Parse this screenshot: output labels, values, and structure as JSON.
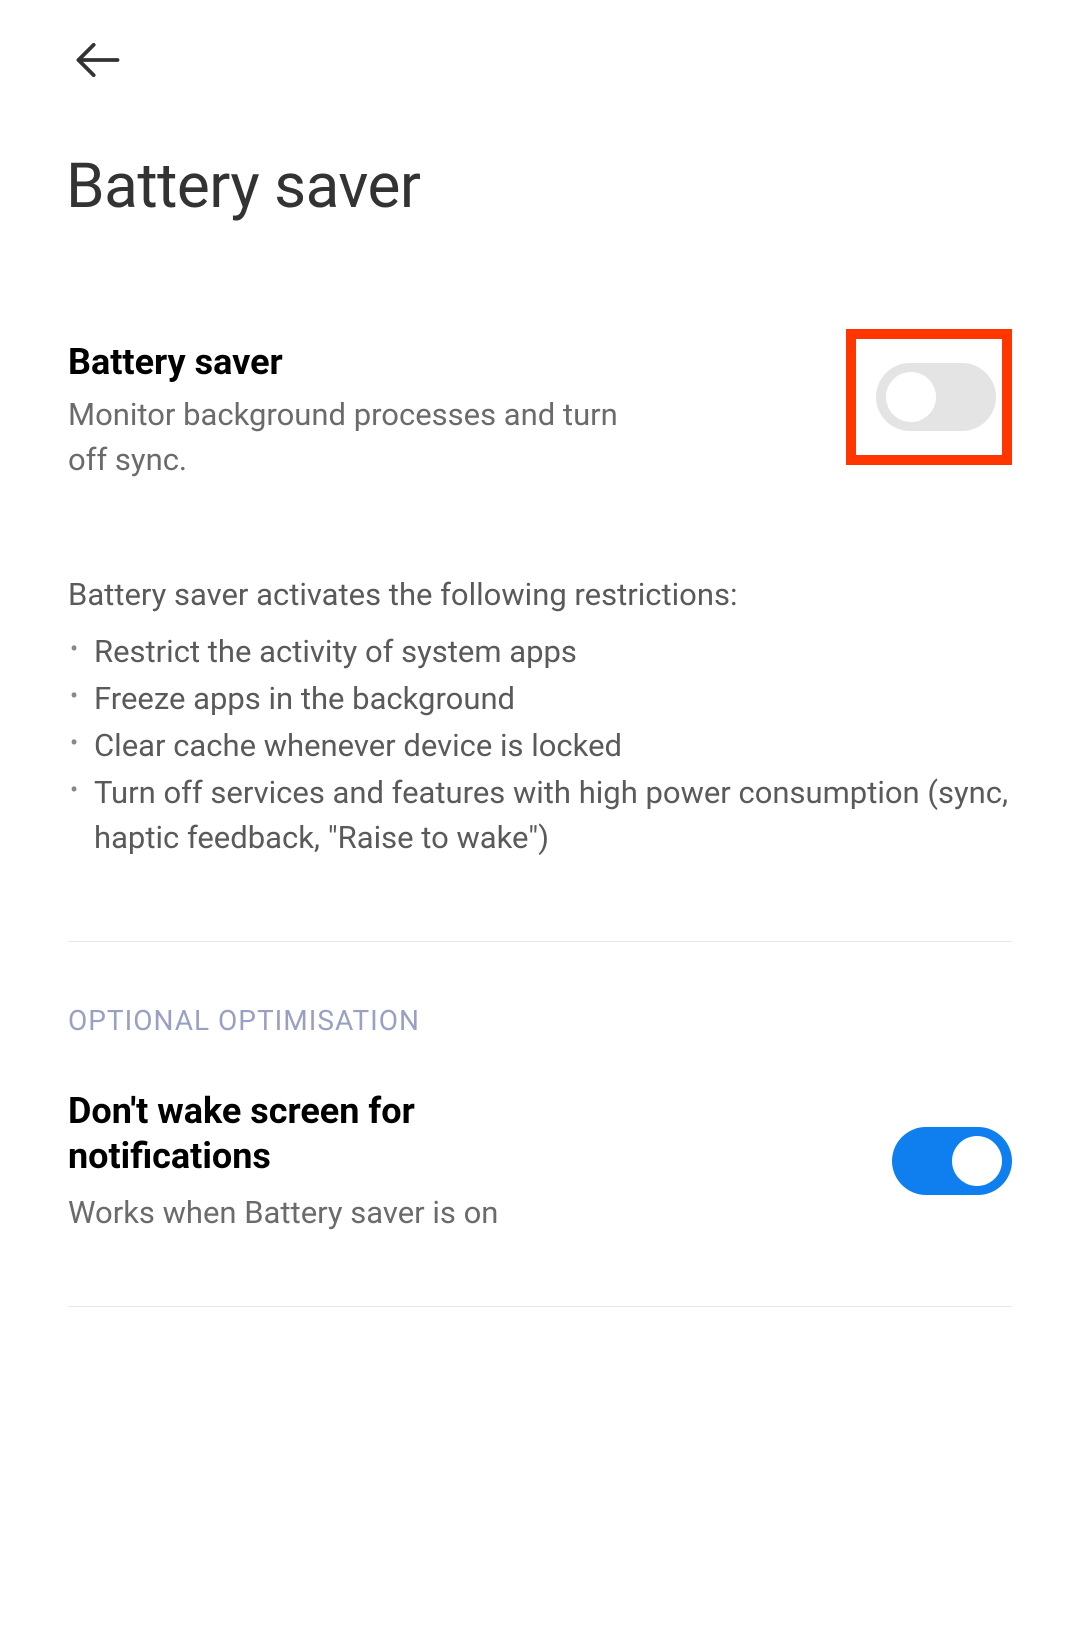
{
  "header": {
    "page_title": "Battery saver"
  },
  "battery_saver": {
    "title": "Battery saver",
    "subtitle": "Monitor background processes and turn off sync.",
    "toggle_on": false
  },
  "restrictions": {
    "intro": "Battery saver activates the following restrictions:",
    "items": [
      "Restrict the activity of system apps",
      "Freeze apps in the background",
      "Clear cache whenever device is locked",
      "Turn off services and features with high power consumption (sync, haptic feedback, \"Raise to wake\")"
    ]
  },
  "optional_section": {
    "header": "OPTIONAL OPTIMISATION",
    "dont_wake": {
      "title": "Don't wake screen for notifications",
      "subtitle": "Works when Battery saver is on",
      "toggle_on": true
    }
  },
  "highlight": {
    "color": "#ff3600"
  }
}
